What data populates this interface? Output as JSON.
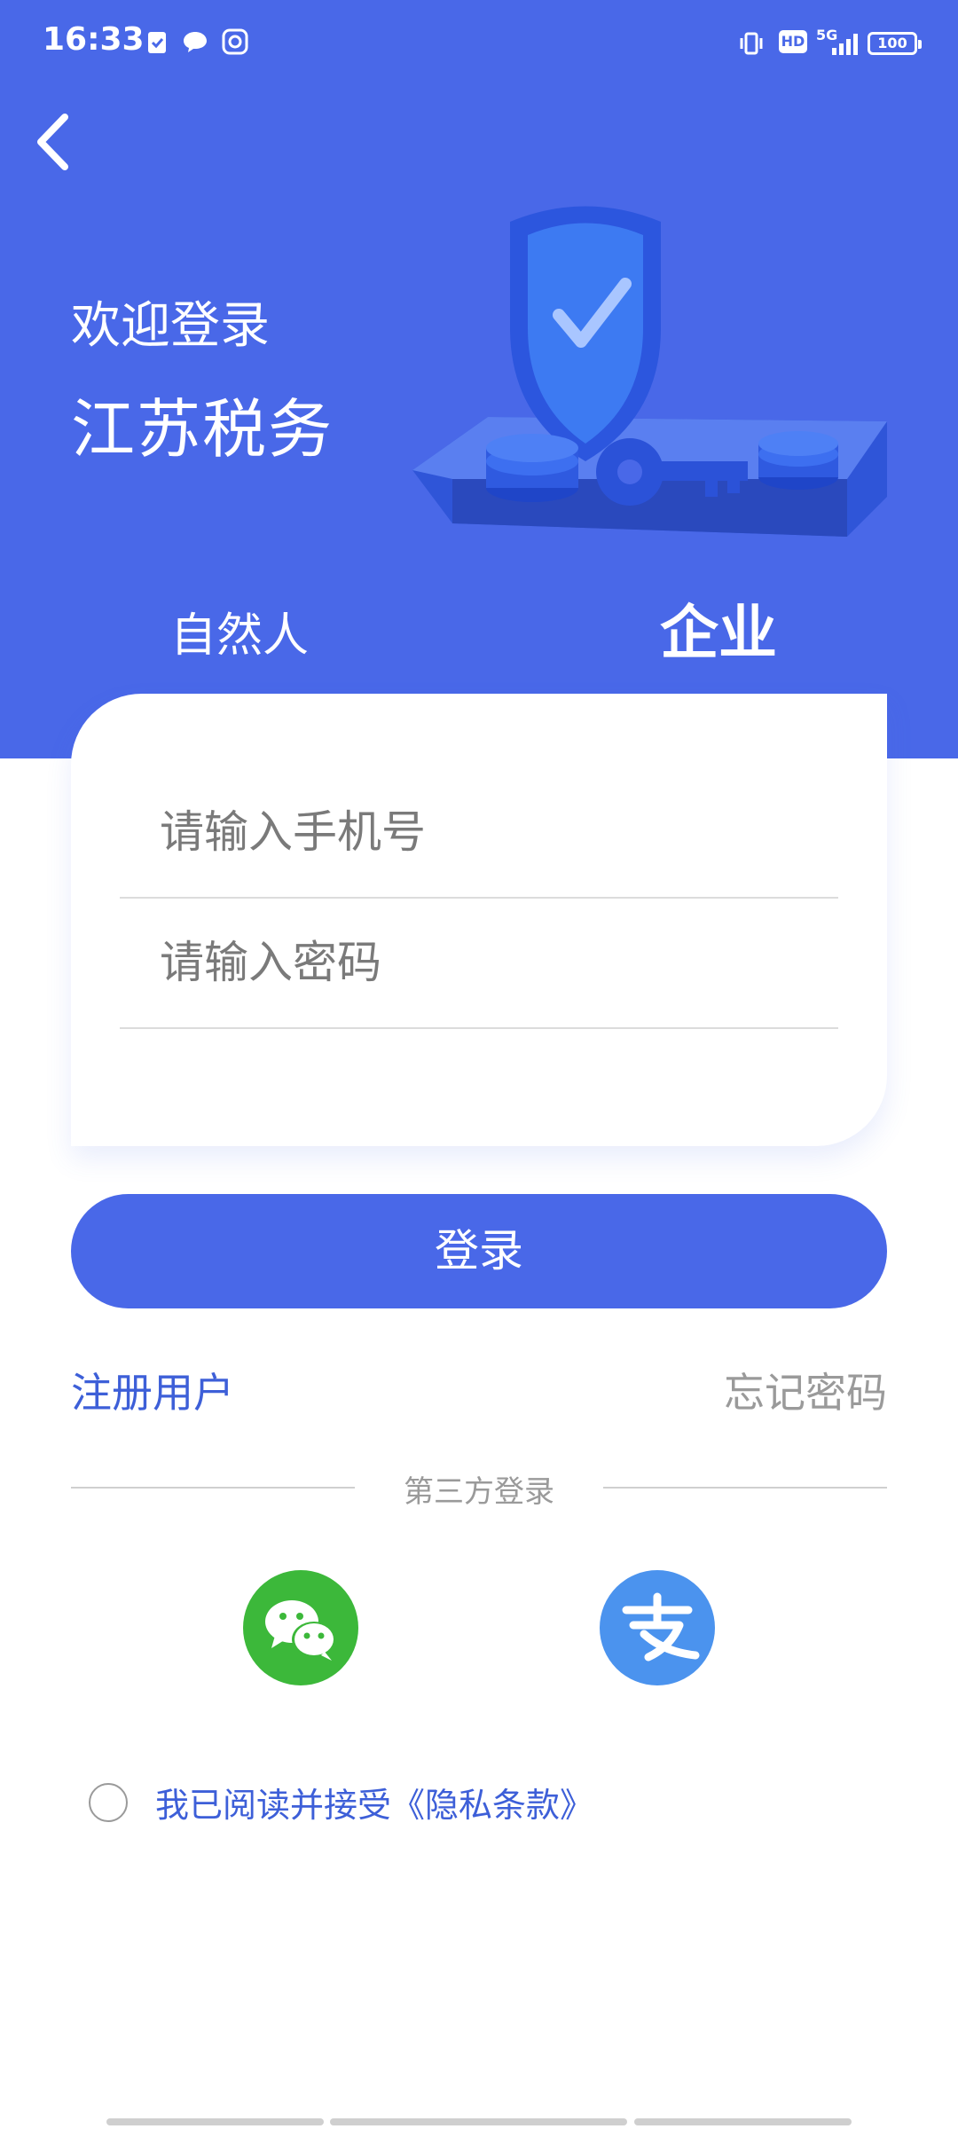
{
  "status_bar": {
    "time": "16:33",
    "hd": "HD",
    "network": "5G",
    "battery": "100"
  },
  "header": {
    "welcome": "欢迎登录",
    "app_name": "江苏税务"
  },
  "tabs": [
    {
      "label": "自然人",
      "active": false
    },
    {
      "label": "企业",
      "active": true
    }
  ],
  "form": {
    "phone_placeholder": "请输入手机号",
    "password_placeholder": "请输入密码"
  },
  "login_button": "登录",
  "links": {
    "register": "注册用户",
    "forgot": "忘记密码"
  },
  "third_party": {
    "label": "第三方登录",
    "providers": [
      {
        "name": "wechat",
        "color": "#3cb83a"
      },
      {
        "name": "alipay",
        "color": "#4b93ee"
      }
    ]
  },
  "agreement": "我已阅读并接受《隐私条款》",
  "colors": {
    "primary": "#4968e8",
    "link": "#3d5fd8",
    "muted": "#9a9a9a"
  }
}
